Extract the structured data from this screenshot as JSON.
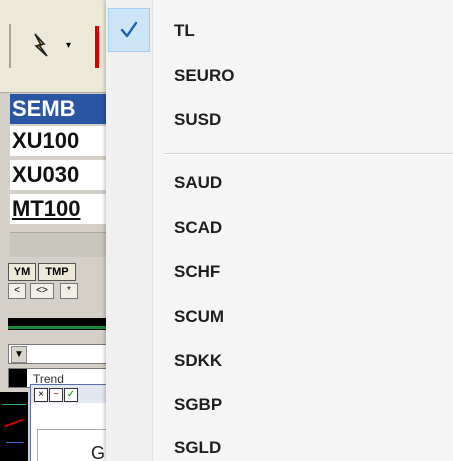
{
  "background_app": {
    "toolbar": {
      "tool_dropdown_arrow": "▾"
    },
    "symbol_list": {
      "header": "SEMB",
      "rows": [
        "XU100",
        "XU030",
        "MT100"
      ]
    },
    "mini_buttons": [
      "YM",
      "TMP"
    ],
    "mini_buttons_row2": [
      "<",
      "<>",
      "*"
    ],
    "combo_arrow": "▼",
    "combo_text": "Trend",
    "subwindow": {
      "buttons": [
        "×",
        "~",
        "✓"
      ],
      "label": "G"
    }
  },
  "currency_menu": {
    "items": [
      {
        "label": "TL",
        "checked": true
      },
      {
        "label": "SEURO",
        "checked": false
      },
      {
        "label": "SUSD",
        "checked": false
      },
      {
        "label": "SAUD",
        "checked": false
      },
      {
        "label": "SCAD",
        "checked": false
      },
      {
        "label": "SCHF",
        "checked": false
      },
      {
        "label": "SCUM",
        "checked": false
      },
      {
        "label": "SDKK",
        "checked": false
      },
      {
        "label": "SGBP",
        "checked": false
      },
      {
        "label": "SGLD",
        "checked": false
      }
    ]
  },
  "colors": {
    "menu_background": "#f5f5f5",
    "check_highlight": "#cde6f7",
    "check_mark": "#1a5fb4",
    "header_blue": "#2a55a3",
    "alert_red": "#d40000"
  }
}
